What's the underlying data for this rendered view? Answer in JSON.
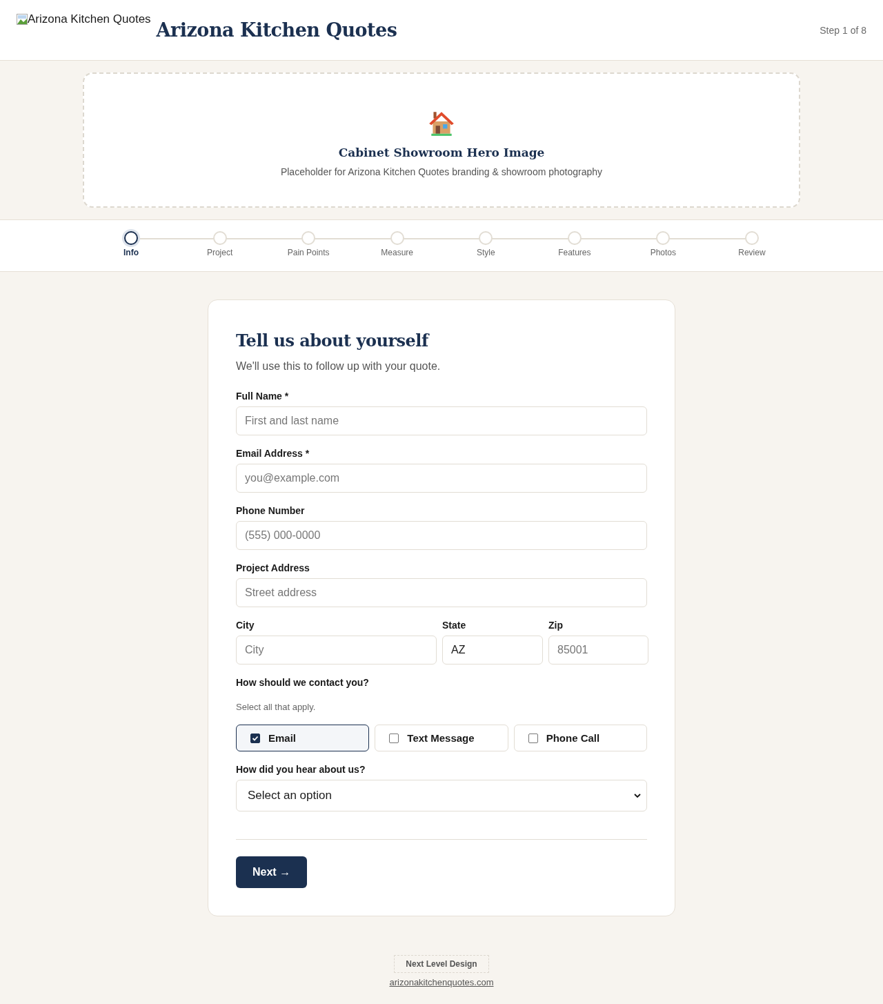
{
  "header": {
    "logo_alt": "Arizona Kitchen Quotes",
    "title": "Arizona Kitchen Quotes",
    "step": "Step 1 of 8"
  },
  "hero": {
    "title": "Cabinet Showroom Hero Image",
    "subtitle": "Placeholder for Arizona Kitchen Quotes branding & showroom photography"
  },
  "steps": [
    {
      "label": "Info",
      "selected": true
    },
    {
      "label": "Project",
      "selected": false
    },
    {
      "label": "Pain Points",
      "selected": false
    },
    {
      "label": "Measure",
      "selected": false
    },
    {
      "label": "Style",
      "selected": false
    },
    {
      "label": "Features",
      "selected": false
    },
    {
      "label": "Photos",
      "selected": false
    },
    {
      "label": "Review",
      "selected": false
    }
  ],
  "form": {
    "title": "Tell us about yourself",
    "subtitle": "We'll use this to follow up with your quote.",
    "rows": [
      [
        {
          "label": "Full Name *",
          "placeholder": "First and last name"
        }
      ],
      [
        {
          "label": "Email Address *",
          "placeholder": "you@example.com"
        }
      ],
      [
        {
          "label": "Phone Number",
          "placeholder": "(555) 000-0000"
        }
      ],
      [
        {
          "label": "Project Address",
          "placeholder": "Street address"
        }
      ],
      [
        {
          "label": "City",
          "placeholder": "City"
        },
        {
          "label": "State",
          "value": "AZ"
        },
        {
          "label": "Zip",
          "placeholder": "85001"
        }
      ]
    ],
    "contact_label": "How should we contact you?",
    "contact_hint": "Select all that apply.",
    "contact_options": [
      {
        "label": "Email",
        "checked": true
      },
      {
        "label": "Text Message",
        "checked": false
      },
      {
        "label": "Phone Call",
        "checked": false
      }
    ],
    "source_label": "How did you hear about us?",
    "source_value": "Select an option",
    "next_button": "Next →"
  },
  "footer": {
    "badge": "Next Level Design",
    "link": "arizonakitchenquotes.com"
  }
}
